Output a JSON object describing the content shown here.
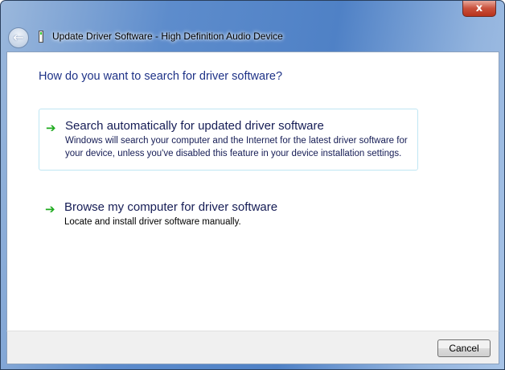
{
  "window": {
    "title": "Update Driver Software - High Definition Audio Device",
    "close_label": "x"
  },
  "nav": {
    "back_glyph": "←"
  },
  "main": {
    "heading": "How do you want to search for driver software?",
    "options": [
      {
        "title": "Search automatically for updated driver software",
        "description": "Windows will search your computer and the Internet for the latest driver software for your device, unless you've disabled this feature in your device installation settings.",
        "icon": "green-arrow-icon",
        "glyph": "➔"
      },
      {
        "title": "Browse my computer for driver software",
        "description": "Locate and install driver software manually.",
        "icon": "green-arrow-icon",
        "glyph": "➔"
      }
    ]
  },
  "footer": {
    "cancel_label": "Cancel"
  }
}
